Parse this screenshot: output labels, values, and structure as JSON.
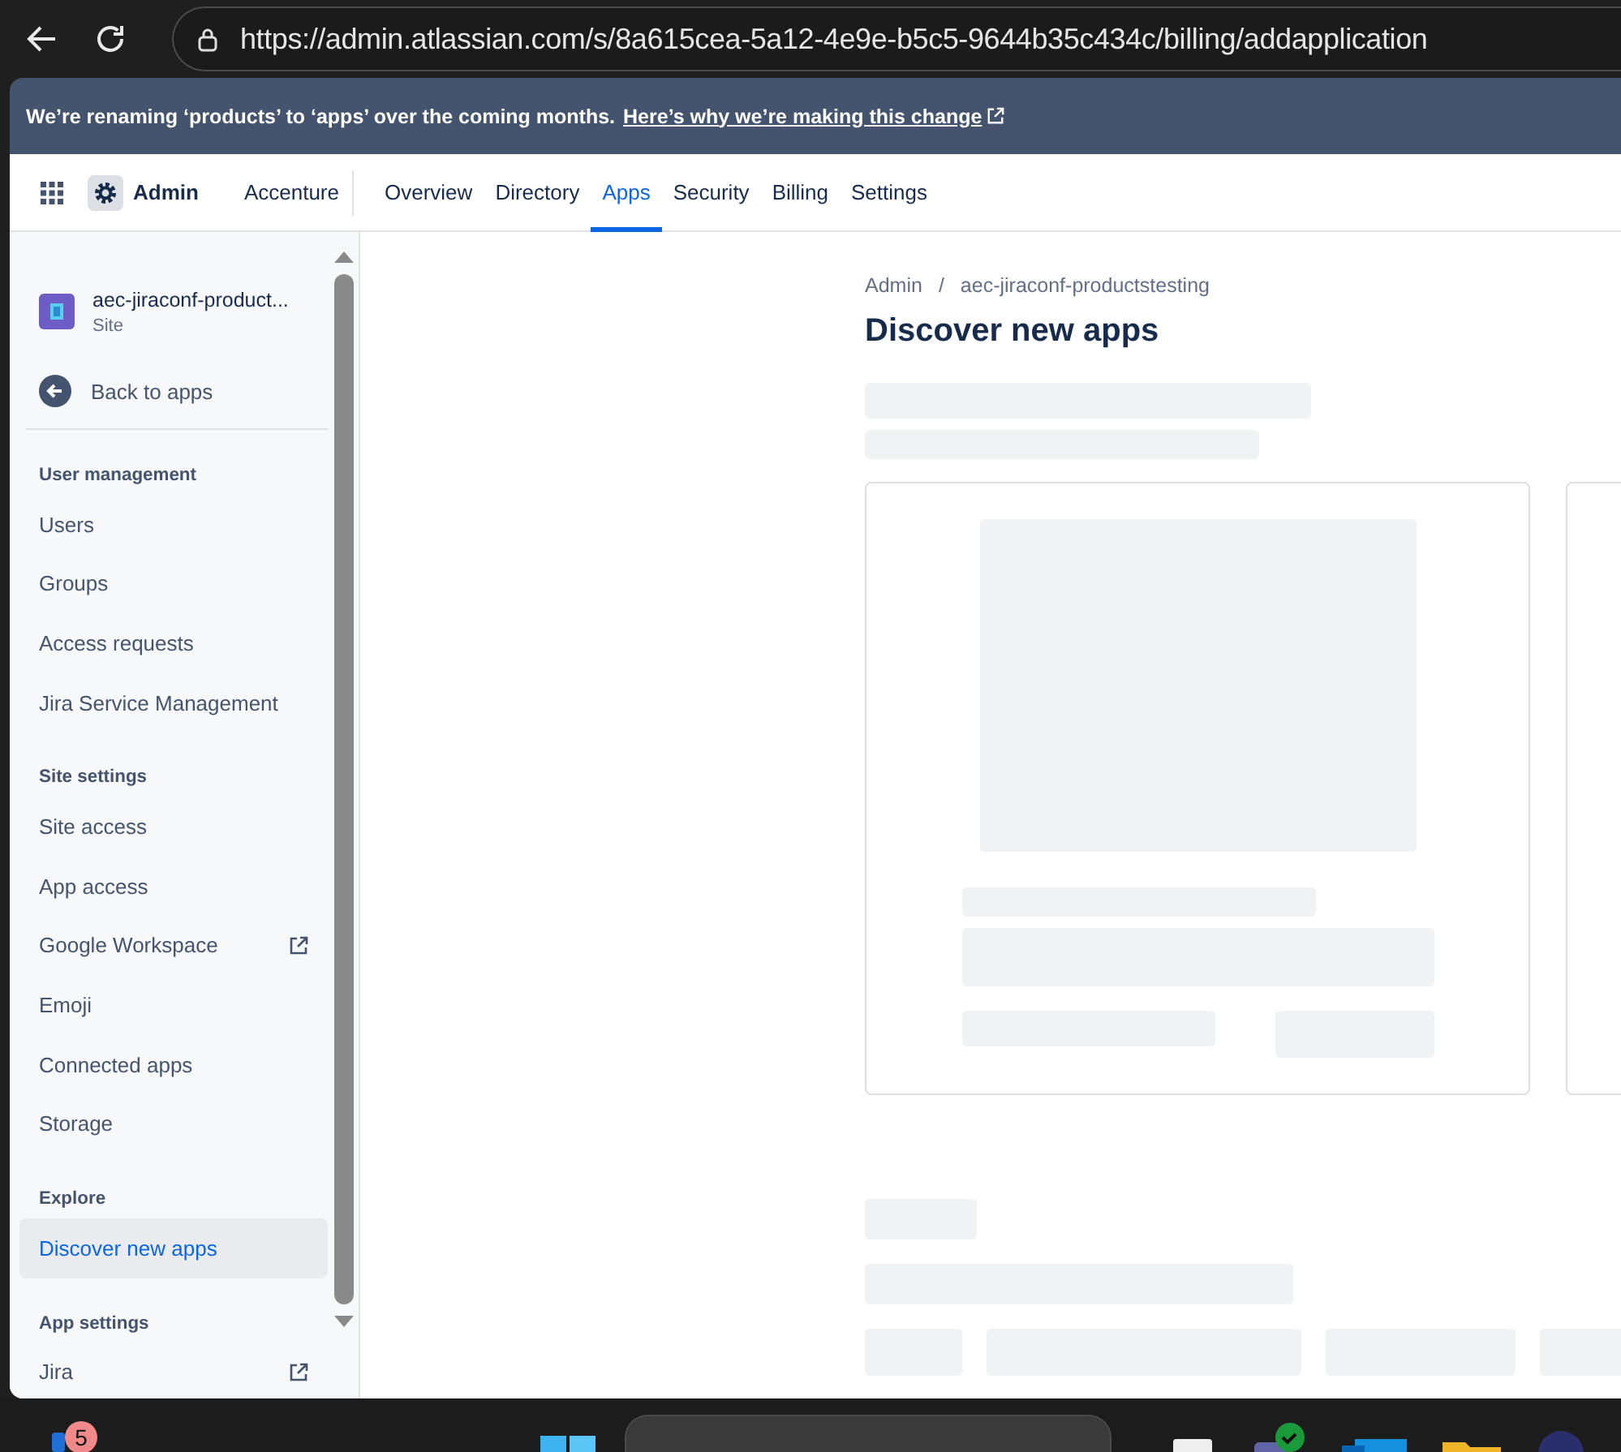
{
  "browser": {
    "url": "https://admin.atlassian.com/s/8a615cea-5a12-4e9e-b5c5-9644b35c434c/billing/addapplication"
  },
  "banner": {
    "text": "We’re renaming ‘products’ to ‘apps’ over the coming months.",
    "link": "Here’s why we’re making this change"
  },
  "nav": {
    "product": "Admin",
    "org": "Accenture",
    "tabs": [
      {
        "label": "Overview",
        "selected": false
      },
      {
        "label": "Directory",
        "selected": false
      },
      {
        "label": "Apps",
        "selected": true
      },
      {
        "label": "Security",
        "selected": false
      },
      {
        "label": "Billing",
        "selected": false
      },
      {
        "label": "Settings",
        "selected": false
      }
    ]
  },
  "sidebar": {
    "site": {
      "name": "aec-jiraconf-product...",
      "type": "Site"
    },
    "back": "Back to apps",
    "sections": [
      {
        "heading": "User management",
        "items": [
          {
            "label": "Users",
            "selected": false,
            "external": false
          },
          {
            "label": "Groups",
            "selected": false,
            "external": false
          },
          {
            "label": "Access requests",
            "selected": false,
            "external": false
          },
          {
            "label": "Jira Service Management",
            "selected": false,
            "external": false
          }
        ]
      },
      {
        "heading": "Site settings",
        "items": [
          {
            "label": "Site access",
            "selected": false,
            "external": false
          },
          {
            "label": "App access",
            "selected": false,
            "external": false
          },
          {
            "label": "Google Workspace",
            "selected": false,
            "external": true
          },
          {
            "label": "Emoji",
            "selected": false,
            "external": false
          },
          {
            "label": "Connected apps",
            "selected": false,
            "external": false
          },
          {
            "label": "Storage",
            "selected": false,
            "external": false
          }
        ]
      },
      {
        "heading": "Explore",
        "items": [
          {
            "label": "Discover new apps",
            "selected": true,
            "external": false
          }
        ]
      },
      {
        "heading": "App settings",
        "items": [
          {
            "label": "Jira",
            "selected": false,
            "external": true
          }
        ]
      }
    ]
  },
  "content": {
    "breadcrumbs": [
      "Admin",
      "aec-jiraconf-productstesting"
    ],
    "breadcrumb_separator": "/",
    "title": "Discover new apps"
  },
  "taskbar": {
    "badge": "5"
  }
}
